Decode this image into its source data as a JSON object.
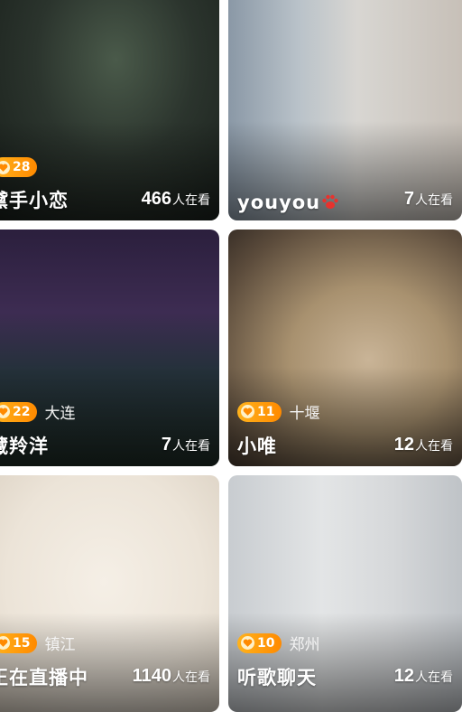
{
  "cards": [
    {
      "name": "黛手小恋",
      "level": "28",
      "city": "",
      "viewers": "466",
      "viewers_unit": "人在看"
    },
    {
      "name": "youyou",
      "name_icon": "paw-icon",
      "level": "",
      "city": "",
      "viewers": "7",
      "viewers_unit": "人在看"
    },
    {
      "name": "藏羚洋",
      "level": "22",
      "city": "大连",
      "viewers": "7",
      "viewers_unit": "人在看"
    },
    {
      "name": "小唯",
      "level": "11",
      "city": "十堰",
      "viewers": "12",
      "viewers_unit": "人在看"
    },
    {
      "name": "正在直播中",
      "level": "15",
      "city": "镇江",
      "viewers": "1140",
      "viewers_unit": "人在看"
    },
    {
      "name": "听歌聊天",
      "level": "10",
      "city": "郑州",
      "viewers": "12",
      "viewers_unit": "人在看"
    }
  ],
  "colors": {
    "badge": "#ff9a10",
    "paw": "#e8322d"
  }
}
